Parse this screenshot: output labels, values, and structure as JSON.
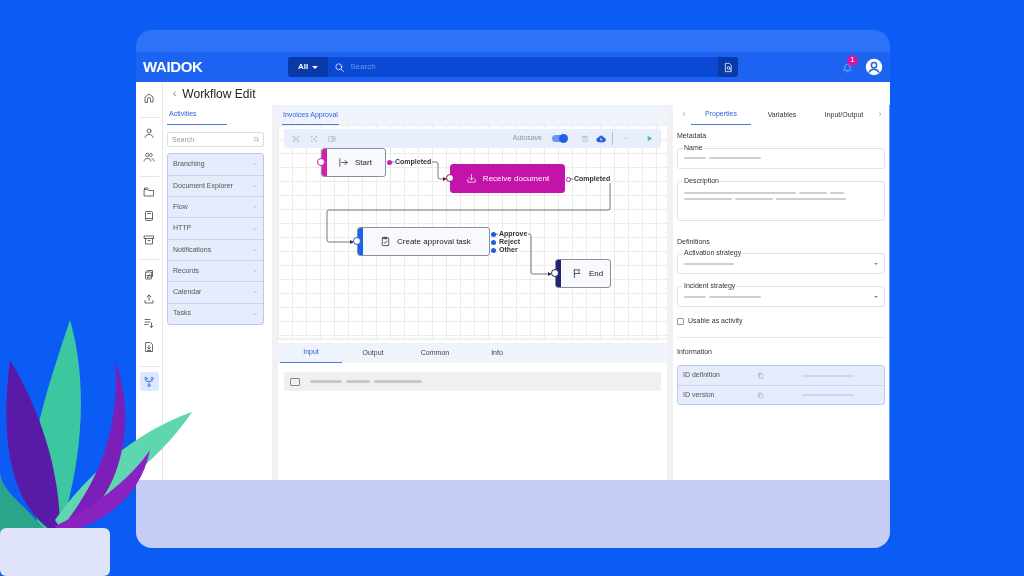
{
  "header": {
    "logo": "WAIDOK",
    "search": {
      "scope": "All",
      "placeholder": "Search"
    },
    "notifications": "1"
  },
  "nav_rail": [
    {
      "selected": false
    },
    {
      "selected": false
    },
    {
      "selected": false
    },
    {
      "selected": false
    },
    {
      "selected": false
    },
    {
      "selected": false
    },
    {
      "selected": false
    },
    {
      "selected": false
    },
    {
      "selected": false
    },
    {
      "selected": false
    },
    {
      "selected": true
    }
  ],
  "page": {
    "back": "‹",
    "title": "Workflow Edit"
  },
  "activities": {
    "tab": {
      "label": "Activities",
      "selected": true
    },
    "search": {
      "placeholder": "Search"
    },
    "categories": [
      {
        "label": "Branching",
        "expanded": false
      },
      {
        "label": "Document Explorer",
        "expanded": false
      },
      {
        "label": "Flow",
        "expanded": false
      },
      {
        "label": "HTTP",
        "expanded": false
      },
      {
        "label": "Notifications",
        "expanded": false
      },
      {
        "label": "Records",
        "expanded": false
      },
      {
        "label": "Calendar",
        "expanded": false
      },
      {
        "label": "Tasks",
        "expanded": false
      }
    ]
  },
  "editor": {
    "tab": {
      "label": "Invoices Approval",
      "selected": true
    },
    "autosave": {
      "label": "Autosave",
      "on": true
    },
    "nodes": [
      {
        "kind": "start",
        "label": "Start",
        "color": "#d21fae",
        "selected": false,
        "outputs": [
          "Completed"
        ]
      },
      {
        "kind": "receive",
        "label": "Receive document",
        "color": "#c313a8",
        "selected": true,
        "outputs": [
          "Completed"
        ]
      },
      {
        "kind": "task",
        "label": "Create approval task",
        "color": "#1f5fe6",
        "selected": false,
        "outputs": [
          "Approve",
          "Reject",
          "Other"
        ]
      },
      {
        "kind": "end",
        "label": "End",
        "color": "#24216e",
        "selected": false
      }
    ]
  },
  "bottom_tabs": [
    {
      "label": "Input",
      "selected": true
    },
    {
      "label": "Output",
      "selected": false
    },
    {
      "label": "Common",
      "selected": false
    },
    {
      "label": "Info",
      "selected": false
    }
  ],
  "input_row": {
    "checked": false
  },
  "properties": {
    "scroll_left": "‹",
    "scroll_right": "›",
    "tabs": [
      {
        "label": "Properties",
        "selected": true
      },
      {
        "label": "Variables",
        "selected": false
      },
      {
        "label": "Input/Output",
        "selected": false
      }
    ],
    "sections": [
      {
        "title": "Metadata",
        "fields": [
          {
            "kind": "text",
            "label": "Name"
          },
          {
            "kind": "textarea",
            "label": "Description"
          }
        ]
      },
      {
        "title": "Definitions",
        "fields": [
          {
            "kind": "select",
            "label": "Activation strategy"
          },
          {
            "kind": "select",
            "label": "Incident strategy"
          }
        ]
      }
    ],
    "checkbox": {
      "label": "Usable as activity",
      "checked": false
    },
    "information": {
      "title": "Information",
      "rows": [
        "ID definition",
        "ID version"
      ]
    }
  }
}
